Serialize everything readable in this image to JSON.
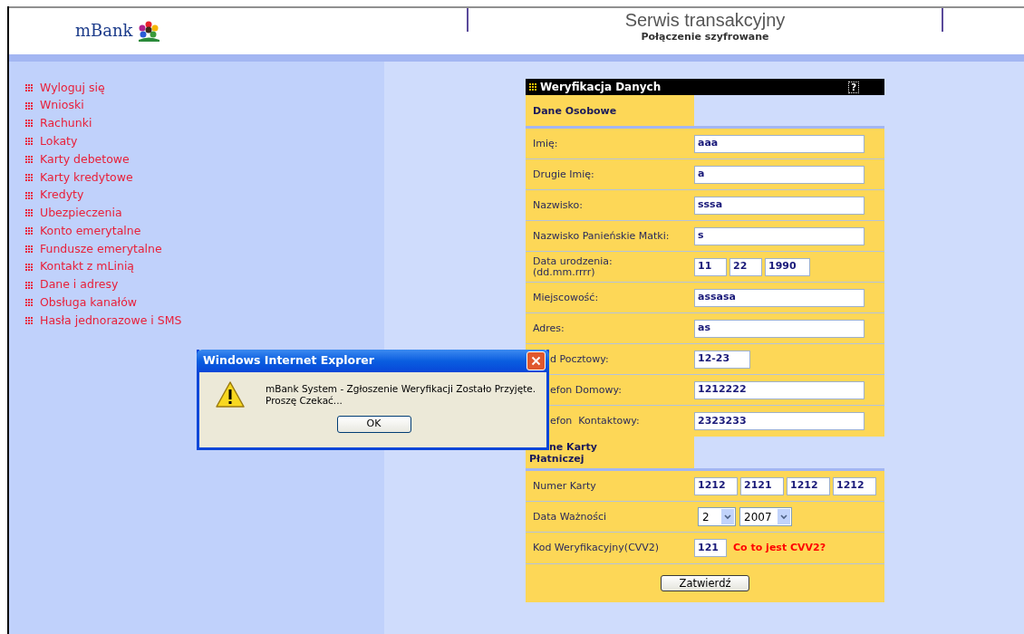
{
  "header": {
    "logo": "mBank",
    "title": "Serwis transakcyjny",
    "subtitle": "Połączenie szyfrowane"
  },
  "menu": [
    {
      "label": "Wyloguj się"
    },
    {
      "label": "Wnioski"
    },
    {
      "label": "Rachunki"
    },
    {
      "label": "Lokaty"
    },
    {
      "label": "Karty debetowe"
    },
    {
      "label": "Karty kredytowe"
    },
    {
      "label": "Kredyty"
    },
    {
      "label": "Ubezpieczenia"
    },
    {
      "label": "Konto emerytalne"
    },
    {
      "label": "Fundusze emerytalne"
    },
    {
      "label": "Kontakt z mLinią"
    },
    {
      "label": "Dane i adresy"
    },
    {
      "label": "Obsługa kanałów"
    },
    {
      "label": "Hasła jednorazowe i SMS"
    }
  ],
  "form": {
    "title": "Weryfikacja Danych",
    "help": "?",
    "submit": "Zatwierdź",
    "sections": [
      {
        "heading": [
          {
            "text": "Dane Osobowe"
          }
        ],
        "rows": [
          {
            "kind": "text",
            "label": "Imię:",
            "value": "aaa"
          },
          {
            "kind": "text",
            "label": "Drugie Imię:",
            "value": "a"
          },
          {
            "kind": "text",
            "label": "Nazwisko:",
            "value": "sssa"
          },
          {
            "kind": "text",
            "label": "Nazwisko Panieńskie Matki:",
            "value": "s"
          },
          {
            "kind": "parts",
            "label": "Data urodzenia:\n(dd.mm.rrrr)",
            "values": [
              "11",
              "22",
              "1990"
            ]
          },
          {
            "kind": "text",
            "label": "Miejscowość:",
            "value": "assasa"
          },
          {
            "kind": "text",
            "label": "Adres:",
            "value": "as"
          },
          {
            "kind": "short",
            "label": "d Pocztowy:",
            "value": "12-23",
            "partly_hidden": true
          },
          {
            "kind": "text",
            "label": "efon Domowy:",
            "value": "1212222",
            "partly_hidden": true
          },
          {
            "kind": "text",
            "label": "efon  Kontaktowy:",
            "value": "2323233",
            "partly_hidden": true
          }
        ]
      },
      {
        "heading": [
          {
            "text": "ne Karty",
            "partly_hidden": true
          },
          {
            "text": "Płatniczej"
          }
        ],
        "rows": [
          {
            "kind": "parts",
            "label": "Numer Karty",
            "values": [
              "1212",
              "2121",
              "1212",
              "1212"
            ]
          },
          {
            "kind": "selects",
            "label": "Data Ważności",
            "values": [
              "2",
              "2007"
            ]
          },
          {
            "kind": "code",
            "label": "Kod Weryfikacyjny(CVV2)",
            "value": "121",
            "link": "Co to jest CVV2?"
          }
        ]
      }
    ]
  },
  "dialog": {
    "title": "Windows Internet Explorer",
    "message": "mBank System - Zgłoszenie Weryfikacji Zostało Przyjęte.\nProszę Czekać...",
    "button": "OK"
  }
}
